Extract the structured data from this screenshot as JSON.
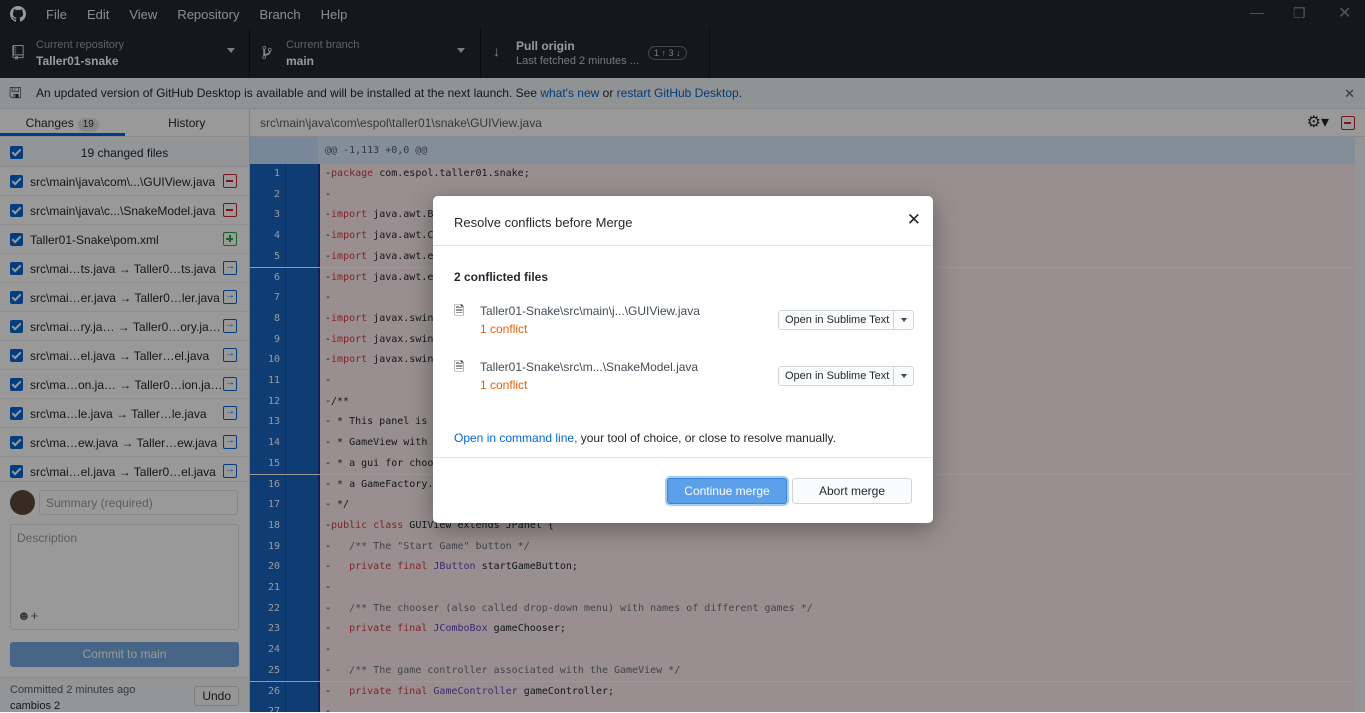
{
  "titlebar": {
    "menu": [
      "File",
      "Edit",
      "View",
      "Repository",
      "Branch",
      "Help"
    ]
  },
  "toolbar": {
    "repo": {
      "label": "Current repository",
      "value": "Taller01-snake"
    },
    "branch": {
      "label": "Current branch",
      "value": "main"
    },
    "pull": {
      "label": "Pull origin",
      "sub": "Last fetched 2 minutes ...",
      "badge": "1 ↑ 3 ↓"
    }
  },
  "banner": {
    "text": "An updated version of GitHub Desktop is available and will be installed at the next launch. See ",
    "link1": "what's new",
    "mid": " or ",
    "link2": "restart GitHub Desktop",
    "end": "."
  },
  "sidebar": {
    "tabs": {
      "changes": "Changes",
      "count": "19",
      "history": "History"
    },
    "all_files": "19 changed files",
    "files": [
      {
        "name": "src\\main\\java\\com\\...\\GUIView.java",
        "status": "deleted"
      },
      {
        "name": "src\\main\\java\\c...\\SnakeModel.java",
        "status": "deleted"
      },
      {
        "name": "Taller01-Snake\\pom.xml",
        "status": "added"
      },
      {
        "name": "src\\mai…ts.java  →  Taller0…ts.java",
        "status": "renamed"
      },
      {
        "name": "src\\mai…er.java  →  Taller0…ler.java",
        "status": "renamed"
      },
      {
        "name": "src\\mai…ry.ja…  →  Taller0…ory.ja…",
        "status": "renamed"
      },
      {
        "name": "src\\mai…el.java  →  Taller…el.java",
        "status": "renamed"
      },
      {
        "name": "src\\ma…on.ja…  →  Taller0…ion.ja…",
        "status": "renamed"
      },
      {
        "name": "src\\ma…le.java  →  Taller…le.java",
        "status": "renamed"
      },
      {
        "name": "src\\ma…ew.java  →  Taller…ew.java",
        "status": "renamed"
      },
      {
        "name": "src\\mai…el.java  →  Taller0…el.java",
        "status": "renamed"
      }
    ],
    "commit": {
      "summary_placeholder": "Summary (required)",
      "description_placeholder": "Description",
      "button": "Commit to main",
      "last": "Committed 2 minutes ago",
      "last_msg": "cambios 2",
      "undo": "Undo"
    }
  },
  "main": {
    "path": "src\\main\\java\\com\\espol\\taller01\\snake\\GUIView.java",
    "hunk": "@@ -1,113 +0,0 @@",
    "lines": [
      {
        "n": "1",
        "code": "-package com.espol.taller01.snake;"
      },
      {
        "n": "2",
        "code": "-"
      },
      {
        "n": "3",
        "code": "-import java.awt.B"
      },
      {
        "n": "4",
        "code": "-import java.awt.C"
      },
      {
        "n": "5",
        "code": "-import java.awt.e"
      },
      {
        "n": "6",
        "code": "-import java.awt.e"
      },
      {
        "n": "7",
        "code": "-"
      },
      {
        "n": "8",
        "code": "-import javax.swin"
      },
      {
        "n": "9",
        "code": "-import javax.swin"
      },
      {
        "n": "10",
        "code": "-import javax.swin"
      },
      {
        "n": "11",
        "code": "-"
      },
      {
        "n": "12",
        "code": "-/**"
      },
      {
        "n": "13",
        "code": "- * This panel is"
      },
      {
        "n": "14",
        "code": "- * GameView with"
      },
      {
        "n": "15",
        "code": "- * a gui for choo"
      },
      {
        "n": "16",
        "code": "- * a GameFactory."
      },
      {
        "n": "17",
        "code": "- */"
      },
      {
        "n": "18",
        "code": "-public class GUIView extends JPanel {"
      },
      {
        "n": "19",
        "code": "-   /** The \"Start Game\" button */"
      },
      {
        "n": "20",
        "code": "-   private final JButton startGameButton;"
      },
      {
        "n": "21",
        "code": "-"
      },
      {
        "n": "22",
        "code": "-   /** The chooser (also called drop-down menu) with names of different games */"
      },
      {
        "n": "23",
        "code": "-   private final JComboBox gameChooser;"
      },
      {
        "n": "24",
        "code": "-"
      },
      {
        "n": "25",
        "code": "-   /** The game controller associated with the GameView */"
      },
      {
        "n": "26",
        "code": "-   private final GameController gameController;"
      },
      {
        "n": "27",
        "code": "-"
      }
    ]
  },
  "modal": {
    "title": "Resolve conflicts before Merge",
    "subtitle": "2 conflicted files",
    "files": [
      {
        "name": "Taller01-Snake\\src\\main\\j...\\GUIView.java",
        "conflicts": "1 conflict",
        "action": "Open in Sublime Text"
      },
      {
        "name": "Taller01-Snake\\src\\m...\\SnakeModel.java",
        "conflicts": "1 conflict",
        "action": "Open in Sublime Text"
      }
    ],
    "hint_link": "Open in command line,",
    "hint_text": " your tool of choice, or close to resolve manually.",
    "continue": "Continue merge",
    "abort": "Abort merge"
  }
}
